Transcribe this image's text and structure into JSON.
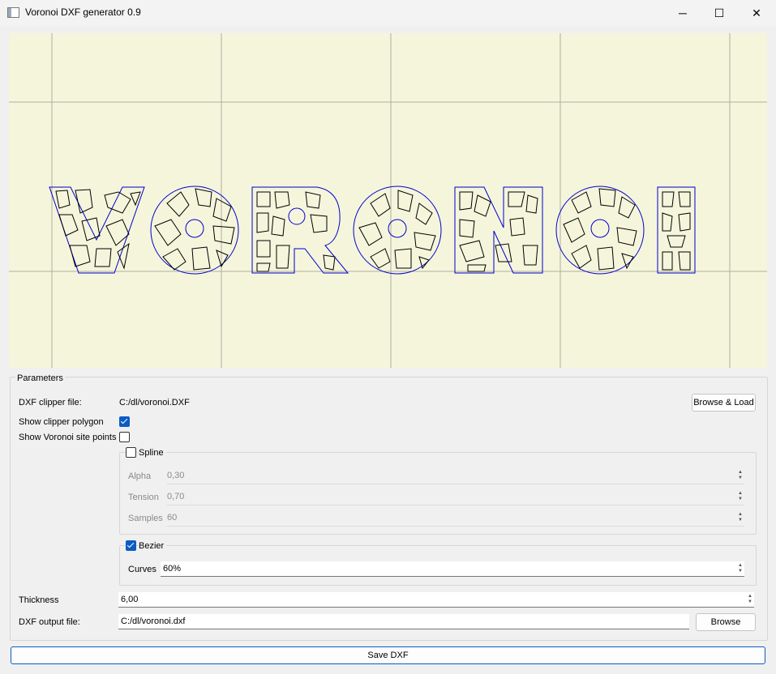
{
  "window": {
    "title": "Voronoi DXF generator 0.9",
    "minimize": "─",
    "maximize": "☐",
    "close": "✕"
  },
  "canvas": {
    "background": "#f5f5dc",
    "outline_color": "#0000cc",
    "cell_color": "#000000",
    "grid_color": "#b0b0a0"
  },
  "params": {
    "group_title": "Parameters",
    "clipper_label": "DXF clipper file:",
    "clipper_value": "C:/dl/voronoi.DXF",
    "browse_load": "Browse & Load",
    "show_clipper_label": "Show clipper polygon",
    "show_clipper_checked": true,
    "show_sites_label": "Show Voronoi site points",
    "show_sites_checked": false,
    "spline": {
      "title": "Spline",
      "checked": false,
      "alpha_label": "Alpha",
      "alpha_value": "0,30",
      "tension_label": "Tension",
      "tension_value": "0,70",
      "samples_label": "Samples",
      "samples_value": "60"
    },
    "bezier": {
      "title": "Bezier",
      "checked": true,
      "curves_label": "Curves",
      "curves_value": "60%"
    },
    "thickness_label": "Thickness",
    "thickness_value": "6,00",
    "output_label": "DXF output file:",
    "output_value": "C:/dl/voronoi.dxf",
    "browse": "Browse"
  },
  "save_label": "Save DXF"
}
